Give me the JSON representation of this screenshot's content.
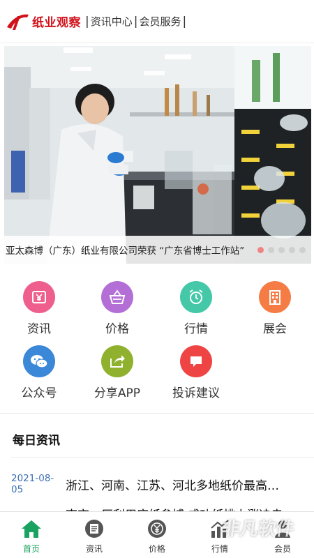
{
  "header": {
    "logo_text": "纸业观察",
    "nav": [
      "资讯中心",
      "会员服务"
    ],
    "separator": "|"
  },
  "banner": {
    "caption": "亚太森博（广东）纸业有限公司荣获 “广东省博士工作站”",
    "slide_count": 5,
    "active_slide": 1
  },
  "grid": {
    "items": [
      {
        "label": "资讯",
        "color": "#ef5f8d",
        "icon": "yen-ticket-icon"
      },
      {
        "label": "价格",
        "color": "#b36fd6",
        "icon": "basket-icon"
      },
      {
        "label": "行情",
        "color": "#44c8a8",
        "icon": "alarm-clock-icon"
      },
      {
        "label": "展会",
        "color": "#f57d45",
        "icon": "building-icon"
      },
      {
        "label": "公众号",
        "color": "#3b87d8",
        "icon": "wechat-icon"
      },
      {
        "label": "分享APP",
        "color": "#8fb12e",
        "icon": "share-icon"
      },
      {
        "label": "投诉建议",
        "color": "#ef4444",
        "icon": "message-icon"
      }
    ]
  },
  "daily": {
    "title": "每日资讯",
    "items": [
      {
        "date": "2021-08-05",
        "title": "浙江、河南、江苏、河北多地纸价最高…"
      },
      {
        "date": "",
        "title": "南京、厂利用废纸叁搏 成功纸桃上涨决走"
      }
    ]
  },
  "tabbar": {
    "items": [
      {
        "label": "首页",
        "icon": "home-icon",
        "active": true
      },
      {
        "label": "资讯",
        "icon": "news-icon",
        "active": false
      },
      {
        "label": "价格",
        "icon": "price-icon",
        "active": false
      },
      {
        "label": "行情",
        "icon": "chart-icon",
        "active": false
      },
      {
        "label": "会员",
        "icon": "member-icon",
        "active": false
      }
    ]
  },
  "colors": {
    "brand_red": "#d0121b",
    "active_green": "#1aa260",
    "date_blue": "#3b6fb6"
  },
  "watermark": "非凡软件"
}
